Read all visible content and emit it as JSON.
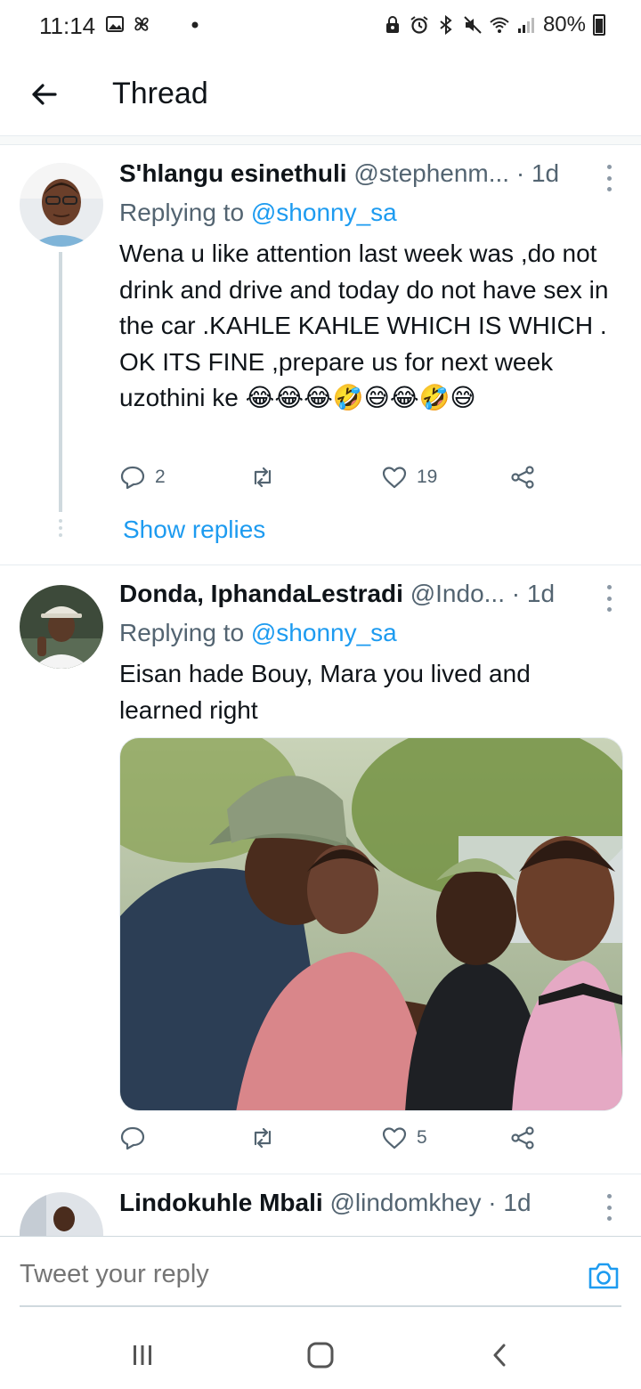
{
  "status_bar": {
    "time": "11:14",
    "battery": "80%",
    "left_icons": [
      "gallery-icon",
      "fan-icon",
      "moon-icon",
      "dot-icon"
    ],
    "right_icons": [
      "lock-icon",
      "alarm-icon",
      "bluetooth-icon",
      "mute-icon",
      "wifi-icon",
      "signal-icon",
      "battery-icon"
    ]
  },
  "header": {
    "title": "Thread"
  },
  "tweets": [
    {
      "name": "S'hlangu esinethuli",
      "handle": "@stephenm...",
      "dot": " · ",
      "time": "1d",
      "replying_prefix": "Replying to ",
      "replying_to": "@shonny_sa",
      "body": "Wena u like attention last week was ,do not drink and drive and today do not have sex in the car .KAHLE KAHLE WHICH IS WHICH .\nOK ITS FINE ,prepare us for next week uzothini ke 😂😂😂🤣😅😂🤣😅",
      "replies": "2",
      "retweets": "",
      "likes": "19",
      "show_replies": "Show replies"
    },
    {
      "name": "Donda, IphandaLestradi",
      "handle": "@Indo...",
      "dot": " · ",
      "time": "1d",
      "replying_prefix": "Replying to ",
      "replying_to": "@shonny_sa",
      "body": "Eisan hade Bouy, Mara you lived and learned right",
      "replies": "",
      "retweets": "",
      "likes": "5"
    },
    {
      "name": "Lindokuhle Mbali",
      "handle": "@lindomkhey",
      "dot": " · ",
      "time": "1d"
    }
  ],
  "reply_bar": {
    "placeholder": "Tweet your reply"
  },
  "colors": {
    "accent": "#1d9bf0",
    "text": "#0f1419",
    "secondary": "#536471",
    "divider": "#e6ecf0"
  }
}
